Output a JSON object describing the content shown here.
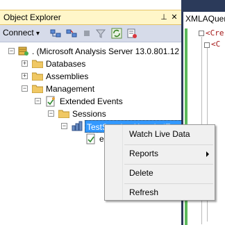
{
  "panel": {
    "title": "Object Explorer",
    "pin_glyph": "⊥",
    "close_glyph": "✕"
  },
  "toolbar": {
    "connect_label": "Connect",
    "connect_arrow": "▾"
  },
  "tree": {
    "server": ". (Microsoft Analysis Server 13.0.801.12",
    "databases": "Databases",
    "assemblies": "Assemblies",
    "management": "Management",
    "extended_events": "Extended Events",
    "sessions": "Sessions",
    "session_name": "TestSession XtendedEvents",
    "child": "e"
  },
  "doc": {
    "tab_title": "XMLAQuer",
    "line1": "<Cre",
    "line2": "<C"
  },
  "context_menu": {
    "items": [
      {
        "label": "Watch Live Data"
      },
      {
        "label": "Reports"
      },
      {
        "label": "Delete"
      },
      {
        "label": "Refresh"
      }
    ]
  },
  "colors": {
    "title_bg": "#fff6c9",
    "selection": "#3399ff",
    "toolbar_bg": "#d6dbe9",
    "doc_bg": "#2b3a5a"
  }
}
